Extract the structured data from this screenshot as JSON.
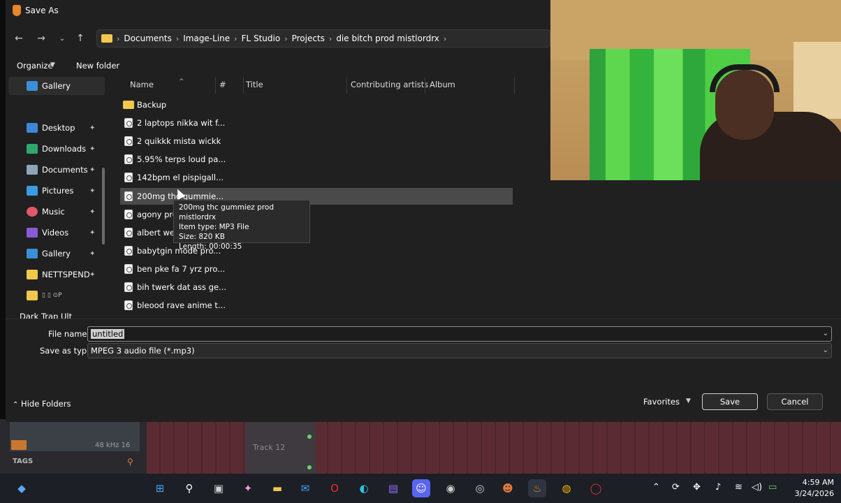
{
  "window": {
    "title": "Save As"
  },
  "breadcrumb": [
    "Documents",
    "Image-Line",
    "FL Studio",
    "Projects",
    "die bitch prod mistlordrx"
  ],
  "toolbar": {
    "organize": "Organize",
    "new_folder": "New folder"
  },
  "sidebar": {
    "items": [
      {
        "label": "Gallery",
        "pinned": false
      },
      {
        "label": "Desktop",
        "pinned": true
      },
      {
        "label": "Downloads",
        "pinned": true
      },
      {
        "label": "Documents",
        "pinned": true
      },
      {
        "label": "Pictures",
        "pinned": true
      },
      {
        "label": "Music",
        "pinned": true
      },
      {
        "label": "Videos",
        "pinned": true
      },
      {
        "label": "Gallery",
        "pinned": true
      },
      {
        "label": "NETTSPEND",
        "pinned": true
      },
      {
        "label": "Dark Trap Ult",
        "pinned": false
      }
    ]
  },
  "columns": [
    "Name",
    "#",
    "Title",
    "Contributing artists",
    "Album"
  ],
  "files": [
    "Backup",
    "2 laptops nikka wit f...",
    "2 quikkk mista wickk",
    "5.95% terps loud pa...",
    "142bpm el pispigall...",
    "200mg thc gummie...",
    "agony pro",
    "albert wes",
    "babytgin mode pro...",
    "ben pke fa 7 yrz pro...",
    "bih twerk dat ass ge...",
    "bleood rave anime t..."
  ],
  "tooltip": {
    "name": "200mg thc gummiez prod mistlordrx",
    "type": "Item type: MP3 File",
    "size": "Size: 820 KB",
    "length": "Length: 00:00:35"
  },
  "form": {
    "file_name_label": "File name:",
    "file_name_value": "untitled",
    "save_type_label": "Save as type:",
    "save_type_value": "MPEG 3 audio file (*.mp3)"
  },
  "buttons": {
    "hide_folders": "Hide Folders",
    "favorites": "Favorites",
    "save": "Save",
    "cancel": "Cancel"
  },
  "background_app": {
    "sample_rate": "48 kHz 16",
    "tags": "TAGS",
    "track": "Track 12"
  },
  "taskbar": {
    "time": "4:59 AM",
    "date": "3/24/2026"
  },
  "colors": {
    "accent": "#e7862b",
    "folder": "#f1c84c",
    "dialog_bg": "#202020"
  }
}
